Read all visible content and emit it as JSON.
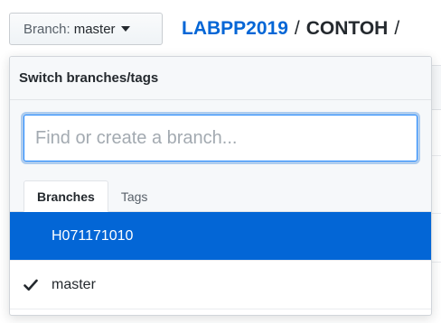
{
  "branch_selector": {
    "prefix": "Branch:",
    "current": "master"
  },
  "breadcrumb": {
    "owner": "LABPP2019",
    "separator": "/",
    "repo": "CONTOH",
    "trailing_separator": "/"
  },
  "dropdown": {
    "title": "Switch branches/tags",
    "filter": {
      "placeholder": "Find or create a branch...",
      "value": ""
    },
    "tabs": [
      {
        "label": "Branches",
        "selected": true
      },
      {
        "label": "Tags",
        "selected": false
      }
    ],
    "items": [
      {
        "label": "H071171010",
        "highlighted": true,
        "checked": false
      },
      {
        "label": "master",
        "highlighted": false,
        "checked": true
      }
    ]
  },
  "colors": {
    "link": "#0366d6",
    "highlight": "#0366d6",
    "focus_ring": "#2188ff"
  },
  "icons": {
    "caret": "caret-down-icon",
    "check": "check-icon"
  }
}
